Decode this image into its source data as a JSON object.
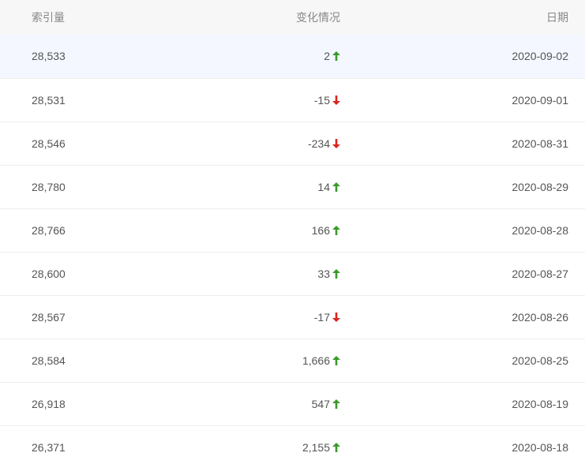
{
  "headers": {
    "index": "索引量",
    "change": "变化情况",
    "date": "日期"
  },
  "colors": {
    "up": "#3a9a2a",
    "down": "#d9251d"
  },
  "rows": [
    {
      "index": "28,533",
      "change": "2",
      "direction": "up",
      "date": "2020-09-02"
    },
    {
      "index": "28,531",
      "change": "-15",
      "direction": "down",
      "date": "2020-09-01"
    },
    {
      "index": "28,546",
      "change": "-234",
      "direction": "down",
      "date": "2020-08-31"
    },
    {
      "index": "28,780",
      "change": "14",
      "direction": "up",
      "date": "2020-08-29"
    },
    {
      "index": "28,766",
      "change": "166",
      "direction": "up",
      "date": "2020-08-28"
    },
    {
      "index": "28,600",
      "change": "33",
      "direction": "up",
      "date": "2020-08-27"
    },
    {
      "index": "28,567",
      "change": "-17",
      "direction": "down",
      "date": "2020-08-26"
    },
    {
      "index": "28,584",
      "change": "1,666",
      "direction": "up",
      "date": "2020-08-25"
    },
    {
      "index": "26,918",
      "change": "547",
      "direction": "up",
      "date": "2020-08-19"
    },
    {
      "index": "26,371",
      "change": "2,155",
      "direction": "up",
      "date": "2020-08-18"
    }
  ]
}
